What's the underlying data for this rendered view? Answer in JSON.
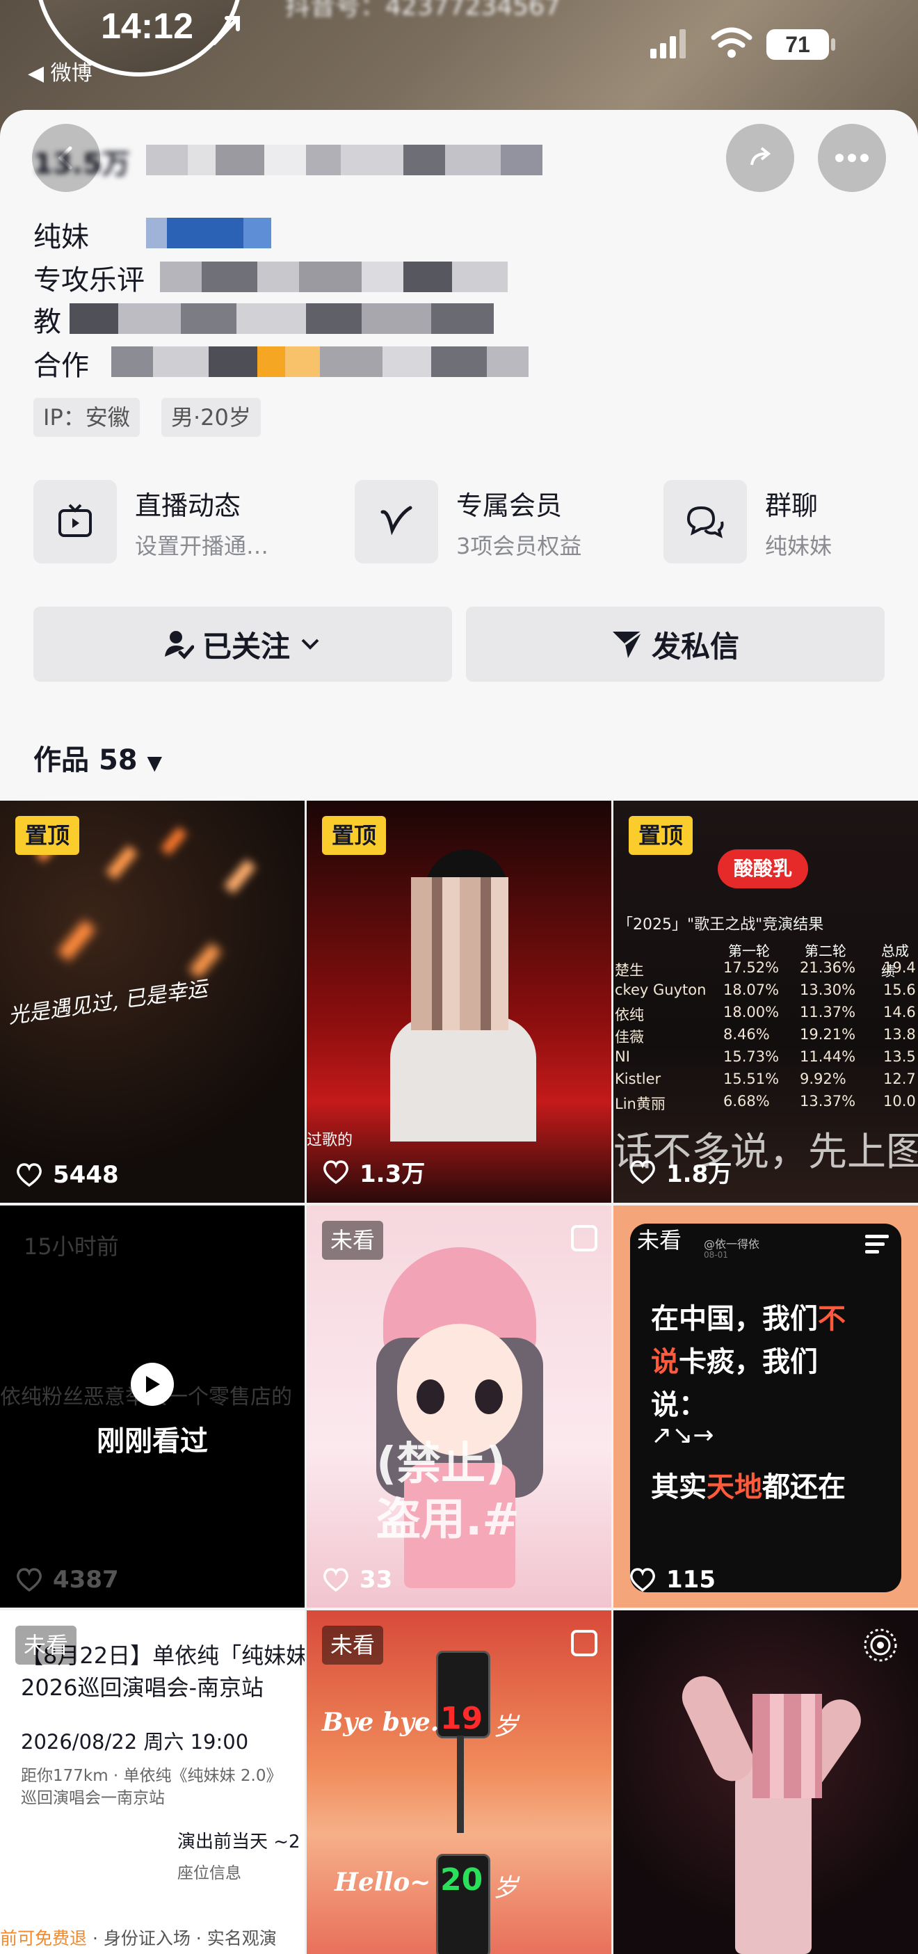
{
  "status": {
    "time": "14:12",
    "back_app": "微博",
    "battery": "71"
  },
  "profile": {
    "douyin_id": "抖音号：42377234567",
    "stats": "13.5万",
    "name": "纯妹",
    "bio_line2": "专攻乐评",
    "bio_line3": "教",
    "bio_line4": "合作",
    "ip_tag": "IP：安徽",
    "gender_age_tag": "男·20岁"
  },
  "features": [
    {
      "title": "直播动态",
      "subtitle": "设置开播通…",
      "icon": "tv-icon"
    },
    {
      "title": "专属会员",
      "subtitle": "3项会员权益",
      "icon": "member-v-icon"
    },
    {
      "title": "群聊",
      "subtitle": "纯妹妹",
      "icon": "group-chat-icon"
    }
  ],
  "buttons": {
    "follow": "已关注",
    "message": "发私信"
  },
  "works": {
    "label": "作品",
    "count": "58"
  },
  "grid": [
    {
      "badge": "置顶",
      "likes": "5448",
      "text": "光是遇见过, 已是幸运"
    },
    {
      "badge": "置顶",
      "likes": "1.3万",
      "text": "过歌的"
    },
    {
      "badge": "置顶",
      "likes": "1.8万",
      "logo": "酸酸乳",
      "title": "「2025」\"歌王之战\"竞演结果",
      "head": [
        "第一轮",
        "第二轮",
        "总成绩"
      ],
      "rows": [
        {
          "name": "楚生",
          "a": "17.52%",
          "b": "21.36%",
          "c": "19.4"
        },
        {
          "name": "ckey Guyton",
          "a": "18.07%",
          "b": "13.30%",
          "c": "15.6"
        },
        {
          "name": "依纯",
          "a": "18.00%",
          "b": "11.37%",
          "c": "14.6"
        },
        {
          "name": "佳薇",
          "a": "8.46%",
          "b": "19.21%",
          "c": "13.8"
        },
        {
          "name": "NI",
          "a": "15.73%",
          "b": "11.44%",
          "c": "13.5"
        },
        {
          "name": "Kistler",
          "a": "15.51%",
          "b": "9.92%",
          "c": "12.7"
        },
        {
          "name": "Lin黄丽",
          "a": "6.68%",
          "b": "13.37%",
          "c": "10.0"
        }
      ],
      "caption": "话不多说，先上图"
    },
    {
      "time": "15小时前",
      "watched": "刚刚看过",
      "likes": "4387",
      "text": "依纯粉丝恶意举报一个零售店的"
    },
    {
      "badge": "未看",
      "likes": "33",
      "overlay1": "(禁止)",
      "overlay2": "盗用.#"
    },
    {
      "badge": "未看",
      "likes": "115",
      "handle": "@依一得依",
      "date": "08-01",
      "line1a": "在中国，我们",
      "line1b": "不",
      "line2a": "说",
      "line2b": "卡痰，我们",
      "line3": "说：",
      "line4a": "其实",
      "line4b": "天地",
      "line4c": "都还在"
    },
    {
      "badge": "未看",
      "title": "【8月22日】单依纯「纯妹妹",
      "title2": "2026巡回演唱会-南京站",
      "date": "2026/08/22 周六 19:00",
      "dist": "距你177km · 单依纯《纯妹妹 2.0》",
      "dist2": "巡回演唱会一南京站",
      "right1": "演出前当天 ~2",
      "right2": "座位信息",
      "footer_a": "前可免费退",
      "footer_b": " · 身份证入场 · 实名观演"
    },
    {
      "badge": "未看",
      "bye": "Bye bye.",
      "n1": "19",
      "sui1": "岁",
      "hello": "Hello~",
      "n2": "20",
      "sui2": "岁"
    },
    {
      "badge": ""
    }
  ],
  "colors": {
    "pin": "#fbcd2c",
    "accent_red": "#ff5a3c",
    "card_bg": "#f7f7f8"
  }
}
